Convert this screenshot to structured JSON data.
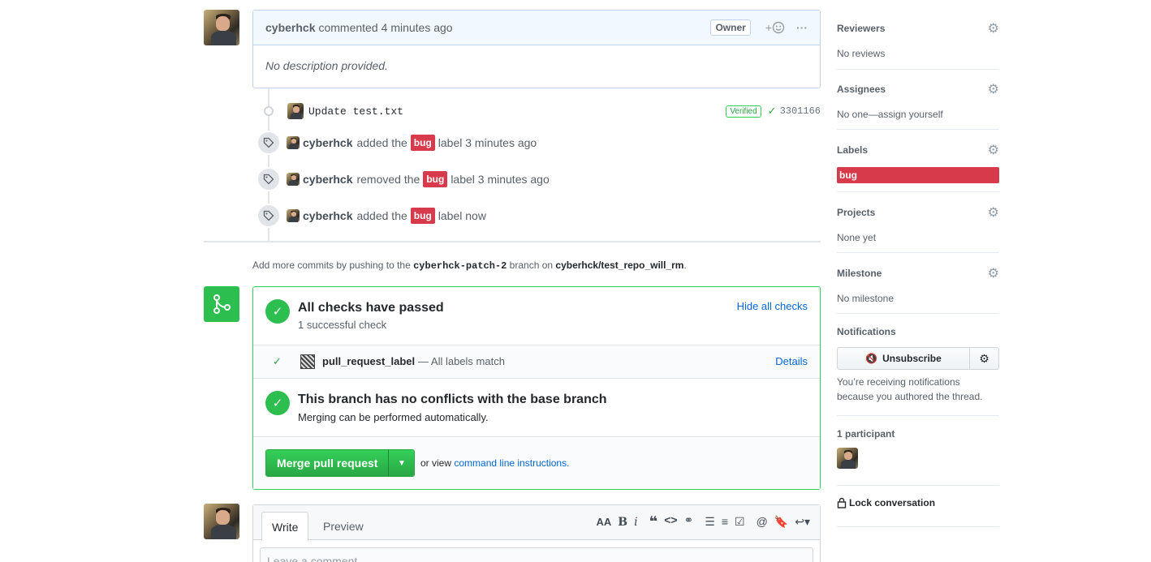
{
  "comment": {
    "author": "cyberhck",
    "action": "commented",
    "time": "4 minutes ago",
    "owner_badge": "Owner",
    "add_reaction": "+",
    "more": "···",
    "body": "No description provided."
  },
  "commit": {
    "message": "Update test.txt",
    "verified": "Verified",
    "sha": "3301166"
  },
  "events": [
    {
      "author": "cyberhck",
      "action": "added the",
      "label": "bug",
      "suffix": "label 3 minutes ago"
    },
    {
      "author": "cyberhck",
      "action": "removed the",
      "label": "bug",
      "suffix": "label 3 minutes ago"
    },
    {
      "author": "cyberhck",
      "action": "added the",
      "label": "bug",
      "suffix": "label now"
    }
  ],
  "push_note": {
    "prefix": "Add more commits by pushing to the",
    "branch": "cyberhck-patch-2",
    "middle": "branch on",
    "repo": "cyberhck/test_repo_will_rm",
    "suffix": "."
  },
  "merge": {
    "checks_title": "All checks have passed",
    "checks_sub": "1 successful check",
    "hide_checks": "Hide all checks",
    "check_name": "pull_request_label",
    "check_desc": "— All labels match",
    "details": "Details",
    "conflict_title": "This branch has no conflicts with the base branch",
    "conflict_sub": "Merging can be performed automatically.",
    "merge_button": "Merge pull request",
    "alt_prefix": "or view",
    "alt_link": "command line instructions",
    "alt_suffix": "."
  },
  "new_comment": {
    "tab_write": "Write",
    "tab_preview": "Preview",
    "placeholder": "Leave a comment"
  },
  "sidebar": {
    "reviewers": {
      "title": "Reviewers",
      "value": "No reviews"
    },
    "assignees": {
      "title": "Assignees",
      "value": "No one—assign yourself"
    },
    "labels": {
      "title": "Labels",
      "value": "bug"
    },
    "projects": {
      "title": "Projects",
      "value": "None yet"
    },
    "milestone": {
      "title": "Milestone",
      "value": "No milestone"
    },
    "notifications": {
      "title": "Notifications",
      "button": "Unsubscribe",
      "note": "You’re receiving notifications because you authored the thread."
    },
    "participants": {
      "title": "1 participant"
    },
    "lock": "Lock conversation"
  },
  "colors": {
    "label_bug": "#d73a4a",
    "success": "#2cbe4e",
    "link": "#0366d6"
  }
}
